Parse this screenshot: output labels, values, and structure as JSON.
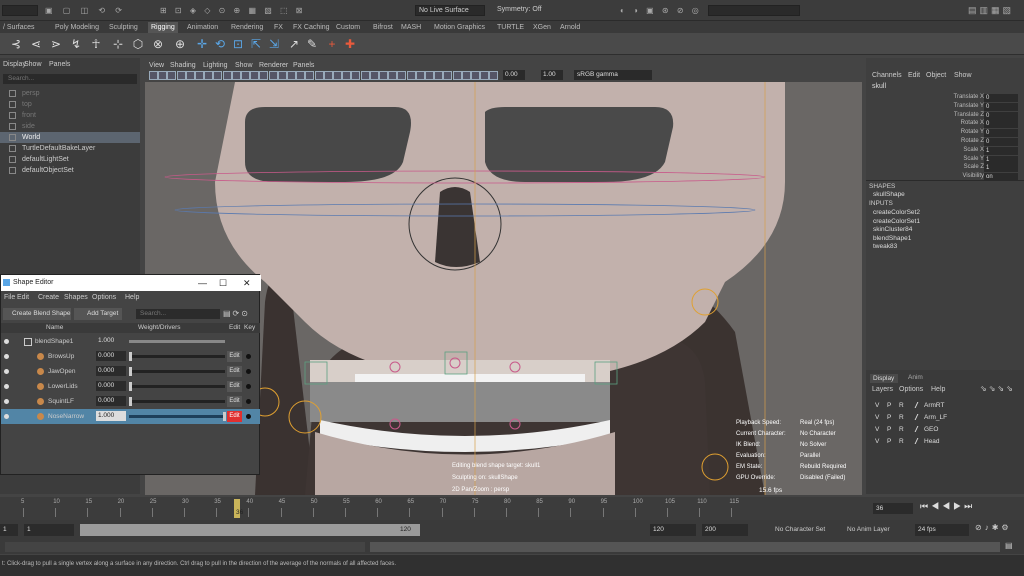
{
  "status": {
    "menuset": "",
    "live_surface": "No Live Surface",
    "symmetry": "Symmetry: Off"
  },
  "shelf_tabs": [
    "/ Surfaces",
    "Poly Modeling",
    "Sculpting",
    "Rigging",
    "Animation",
    "Rendering",
    "FX",
    "FX Caching",
    "Custom",
    "Bifrost",
    "MASH",
    "Motion Graphics",
    "TURTLE",
    "XGen",
    "Arnold"
  ],
  "active_shelf_tab": 3,
  "outliner": {
    "menus": [
      "Display",
      "Show",
      "Panels"
    ],
    "search_placeholder": "Search...",
    "items": [
      {
        "label": "persp",
        "state": "dim"
      },
      {
        "label": "top",
        "state": "dim"
      },
      {
        "label": "front",
        "state": "dim"
      },
      {
        "label": "side",
        "state": "dim"
      },
      {
        "label": "World",
        "state": "sel"
      },
      {
        "label": "TurtleDefaultBakeLayer",
        "state": "normal"
      },
      {
        "label": "defaultLightSet",
        "state": "normal"
      },
      {
        "label": "defaultObjectSet",
        "state": "normal"
      }
    ]
  },
  "viewport": {
    "menus": [
      "View",
      "Shading",
      "Lighting",
      "Show",
      "Renderer",
      "Panels"
    ],
    "exposure": "0.00",
    "gamma": "1.00",
    "colorspace": "sRGB gamma",
    "hud_labels": [
      "Playback Speed:",
      "Current Character:",
      "IK Blend:",
      "Evaluation:",
      "EM State:",
      "GPU Override:"
    ],
    "hud_values": [
      "Real (24 fps)",
      "No Character",
      "No Solver",
      "Parallel",
      "Rebuild Required",
      "Disabled (Failed)"
    ],
    "fps": "15.6 fps",
    "messages": [
      "Editing blend shape target: skull1",
      "Sculpting on: skullShape",
      "2D Pan/Zoom : persp"
    ]
  },
  "channelbox": {
    "menus": [
      "Channels",
      "Edit",
      "Object",
      "Show"
    ],
    "object": "skull",
    "attrs": [
      {
        "name": "Translate X",
        "value": "0"
      },
      {
        "name": "Translate Y",
        "value": "0"
      },
      {
        "name": "Translate Z",
        "value": "0"
      },
      {
        "name": "Rotate X",
        "value": "0"
      },
      {
        "name": "Rotate Y",
        "value": "0"
      },
      {
        "name": "Rotate Z",
        "value": "0"
      },
      {
        "name": "Scale X",
        "value": "1"
      },
      {
        "name": "Scale Y",
        "value": "1"
      },
      {
        "name": "Scale Z",
        "value": "1"
      },
      {
        "name": "Visibility",
        "value": "on"
      }
    ],
    "shapes_header": "SHAPES",
    "shape": "skullShape",
    "inputs_header": "INPUTS",
    "inputs": [
      "createColorSet2",
      "createColorSet1",
      "skinCluster84",
      "blendShape1",
      "tweak83"
    ]
  },
  "layer_editor": {
    "tabs": [
      "Display",
      "Anim"
    ],
    "menus": [
      "Layers",
      "Options",
      "Help"
    ],
    "layers": [
      "ArmRT",
      "Arm_LF",
      "GEO",
      "Head"
    ]
  },
  "shape_editor": {
    "title": "Shape Editor",
    "menus": [
      "File",
      "Edit",
      "Create",
      "Shapes",
      "Options",
      "Help"
    ],
    "create_btn": "Create Blend Shape",
    "add_btn": "Add Target",
    "search_placeholder": "Search...",
    "col_name": "Name",
    "col_weight": "Weight/Drivers",
    "col_edit": "Edit",
    "col_key": "Key",
    "blendshape": {
      "name": "blendShape1",
      "value": "1.000",
      "fill": 1.0
    },
    "targets": [
      {
        "name": "BrowsUp",
        "value": "0.000",
        "fill": 0.0,
        "active": false
      },
      {
        "name": "JawOpen",
        "value": "0.000",
        "fill": 0.0,
        "active": false
      },
      {
        "name": "LowerLids",
        "value": "0.000",
        "fill": 0.0,
        "active": false
      },
      {
        "name": "SquintLF",
        "value": "0.000",
        "fill": 0.0,
        "active": false
      },
      {
        "name": "NoseNarrow",
        "value": "1.000",
        "fill": 1.0,
        "active": true
      }
    ],
    "edit_label": "Edit"
  },
  "timeline": {
    "ticks": [
      "5",
      "10",
      "15",
      "20",
      "25",
      "30",
      "35",
      "40",
      "45",
      "50",
      "55",
      "60",
      "65",
      "70",
      "75",
      "80",
      "85",
      "90",
      "95",
      "100",
      "105",
      "110",
      "115"
    ],
    "current_frame_marker": "36",
    "current_frame": "36",
    "range_start": "1",
    "range_inner_start": "1",
    "range_inner_end": "120",
    "range_end": "120",
    "anim_end": "200",
    "character_set": "No Character Set",
    "anim_layer": "No Anim Layer",
    "fps": "24 fps"
  },
  "help_text": "t: Click-drag to pull a single vertex along a surface in any direction. Ctrl drag to pull in the direction of the average of the normals of all affected faces.",
  "colors": {
    "accent": "#5285a6",
    "edit_active": "#e03030",
    "timeline_marker": "#c9b45a"
  }
}
